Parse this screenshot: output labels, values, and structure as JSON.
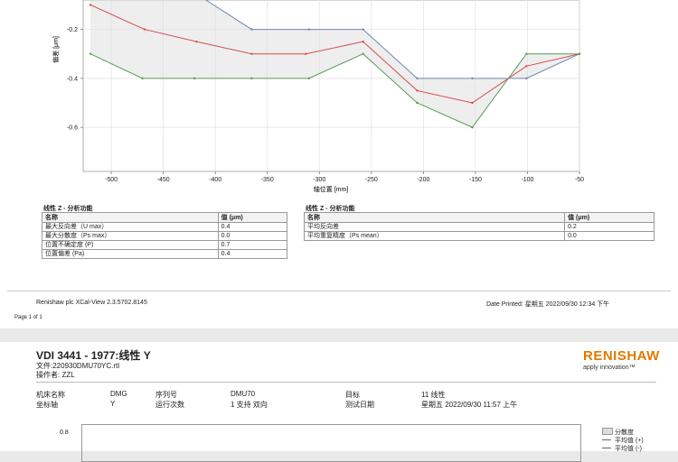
{
  "chart_top": {
    "type": "line",
    "xlabel": "轴位置 [mm]",
    "ylabel": "偏差 [μm]",
    "x_ticks": [
      "-500",
      "-450",
      "-400",
      "-350",
      "-300",
      "-250",
      "-200",
      "-150",
      "-100",
      "-50"
    ],
    "y_ticks": [
      "-0.2",
      "-0.4",
      "-0.6"
    ],
    "xlim": [
      -527,
      -50
    ],
    "ylim": [
      -0.78,
      -0.08
    ],
    "series": [
      {
        "color": "#6f88b3",
        "x": [
          -520,
          -470,
          -420,
          -365,
          -310,
          -258,
          -206,
          -153,
          -101,
          -50
        ],
        "y": [
          0.0,
          0.0,
          -0.05,
          -0.2,
          -0.2,
          -0.2,
          -0.4,
          -0.4,
          -0.4,
          -0.3
        ]
      },
      {
        "color": "#d64b4b",
        "x": [
          -520,
          -468,
          -418,
          -365,
          -313,
          -258,
          -206,
          -153,
          -101,
          -50
        ],
        "y": [
          -0.1,
          -0.2,
          -0.25,
          -0.3,
          -0.3,
          -0.25,
          -0.45,
          -0.5,
          -0.35,
          -0.3
        ]
      },
      {
        "color": "#5b9a58",
        "x": [
          -520,
          -470,
          -420,
          -365,
          -310,
          -258,
          -206,
          -153,
          -101,
          -50
        ],
        "y": [
          -0.3,
          -0.4,
          -0.4,
          -0.4,
          -0.4,
          -0.3,
          -0.5,
          -0.6,
          -0.3,
          -0.3
        ]
      }
    ]
  },
  "table_left": {
    "title": "线性 Z - 分析功能",
    "col1": "名称",
    "col2": "值 (μm)",
    "rows": [
      {
        "name": "最大反向差（U max）",
        "value": "0.4"
      },
      {
        "name": "最大分散度（Ps max）",
        "value": "0.0"
      },
      {
        "name": "位置不确定度 (P)",
        "value": "0.7"
      },
      {
        "name": "位置偏差 (Pa)",
        "value": "0.4"
      }
    ]
  },
  "table_right": {
    "title": "线性 Z - 分析功能",
    "col1": "名称",
    "col2": "值 (μm)",
    "rows": [
      {
        "name": "平均反向差",
        "value": "0.2"
      },
      {
        "name": "平均重复精度（Ps mean）",
        "value": "0.0"
      }
    ]
  },
  "footer": {
    "software": "Renishaw plc XCal-View 2.3.5702.8145",
    "date_printed": "Date Printed: 星期五 2022/09/30 12:34 下午",
    "page": "Page 1 of 1"
  },
  "page2": {
    "title": "VDI 3441 - 1977:线性 Y",
    "file": "文件:220930DMU70YC.rtl",
    "operator": "操作者: ZZL",
    "logo": "RENISHAW",
    "logo_tag": "apply innovation™",
    "machine_label": "机床名称",
    "machine_value": "DMG",
    "serial_label": "序列号",
    "serial_value": "DMU70",
    "target_label": "目标",
    "target_value": "11 线性",
    "axis_label": "坐标轴",
    "axis_value": "Y",
    "runs_label": "运行次数",
    "runs_value": "1 支持 双向",
    "date_label": "测试日期",
    "date_value": "星期五 2022/09/30 11:57 上午",
    "y_tick": "0.8",
    "legend": [
      "分散度",
      "平均值 (+)",
      "平均值 (-)"
    ]
  }
}
